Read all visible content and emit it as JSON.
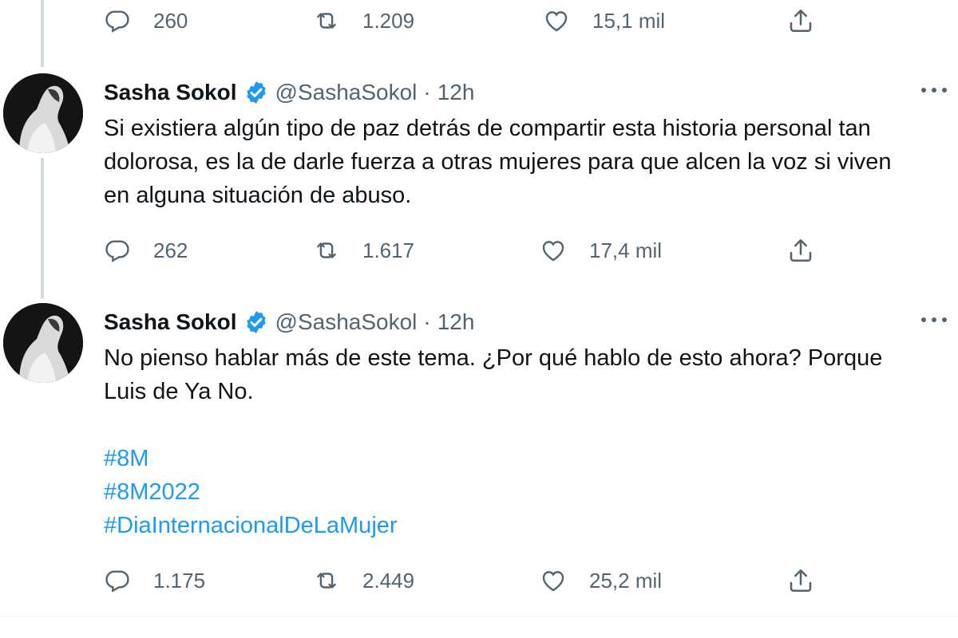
{
  "top_actions": {
    "reply": "260",
    "retweet": "1.209",
    "like": "15,1 mil"
  },
  "tweets": [
    {
      "name": "Sasha Sokol",
      "handle": "@SashaSokol",
      "separator": "·",
      "time": "12h",
      "text_lines": [
        "Si existiera algún tipo de paz detrás de compartir esta historia personal tan",
        "dolorosa, es la de darle fuerza a otras mujeres para que alcen la voz si viven",
        "en alguna situación de abuso."
      ],
      "actions": {
        "reply": "262",
        "retweet": "1.617",
        "like": "17,4 mil"
      }
    },
    {
      "name": "Sasha Sokol",
      "handle": "@SashaSokol",
      "separator": "·",
      "time": "12h",
      "text_lines": [
        "No pienso hablar más de este tema. ¿Por qué hablo de esto ahora? Porque",
        "Luis de Ya No."
      ],
      "hashtags": [
        "#8M",
        "#8M2022",
        "#DiaInternacionalDeLaMujer"
      ],
      "actions": {
        "reply": "1.175",
        "retweet": "2.449",
        "like": "25,2 mil"
      }
    }
  ],
  "icons": {
    "reply": "reply-icon",
    "retweet": "retweet-icon",
    "like": "heart-icon",
    "share": "share-icon",
    "verified": "verified-badge-icon",
    "more": "more-options-icon"
  },
  "colors": {
    "link": "#1d9bf0",
    "secondary": "#536471",
    "verified": "#1d9bf0",
    "thread_line": "#cfd9de"
  }
}
